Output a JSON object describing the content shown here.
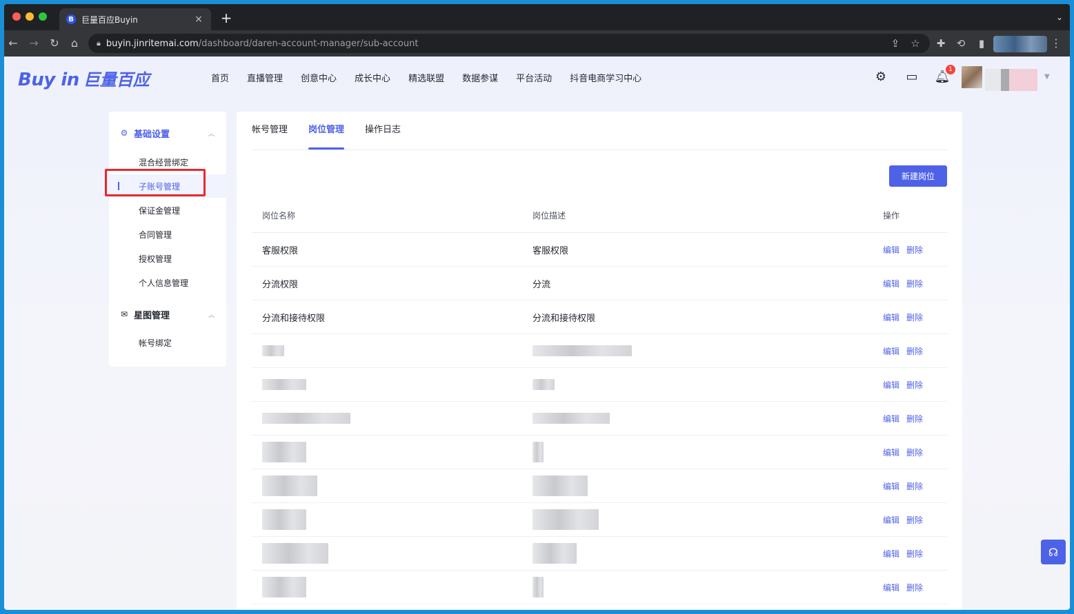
{
  "browser": {
    "tab_title": "巨量百应Buyin",
    "tab_favicon_letter": "B",
    "tab_close": "×",
    "new_tab": "+",
    "tab_menu": "⌄",
    "url_host": "buyin.jinritemai.com",
    "url_path": "/dashboard/daren-account-manager/sub-account"
  },
  "header": {
    "logo_en": "Buy in",
    "logo_cn": "巨量百应",
    "nav": [
      "首页",
      "直播管理",
      "创意中心",
      "成长中心",
      "精选联盟",
      "数据参谋",
      "平台活动",
      "抖音电商学习中心"
    ],
    "notification_count": "1"
  },
  "sidebar": {
    "group1": {
      "label": "基础设置",
      "icon": "gear-icon"
    },
    "group1_items": [
      "混合经营绑定",
      "子账号管理",
      "保证金管理",
      "合同管理",
      "授权管理",
      "个人信息管理"
    ],
    "active_item": "子账号管理",
    "group2": {
      "label": "星图管理",
      "icon": "xingtu-icon"
    },
    "group2_items": [
      "帐号绑定"
    ]
  },
  "main": {
    "tabs": [
      "帐号管理",
      "岗位管理",
      "操作日志"
    ],
    "active_tab": "岗位管理",
    "new_button": "新建岗位",
    "columns": [
      "岗位名称",
      "岗位描述",
      "操作"
    ],
    "rows": [
      {
        "name": "客服权限",
        "desc": "客服权限"
      },
      {
        "name": "分流权限",
        "desc": "分流"
      },
      {
        "name": "分流和接待权限",
        "desc": "分流和接待权限"
      }
    ],
    "blurred_row_count": 8,
    "edit_label": "编辑",
    "delete_label": "删除"
  },
  "colors": {
    "accent": "#4e62e8",
    "highlight_box": "#e8282e",
    "badge": "#f5433d"
  }
}
